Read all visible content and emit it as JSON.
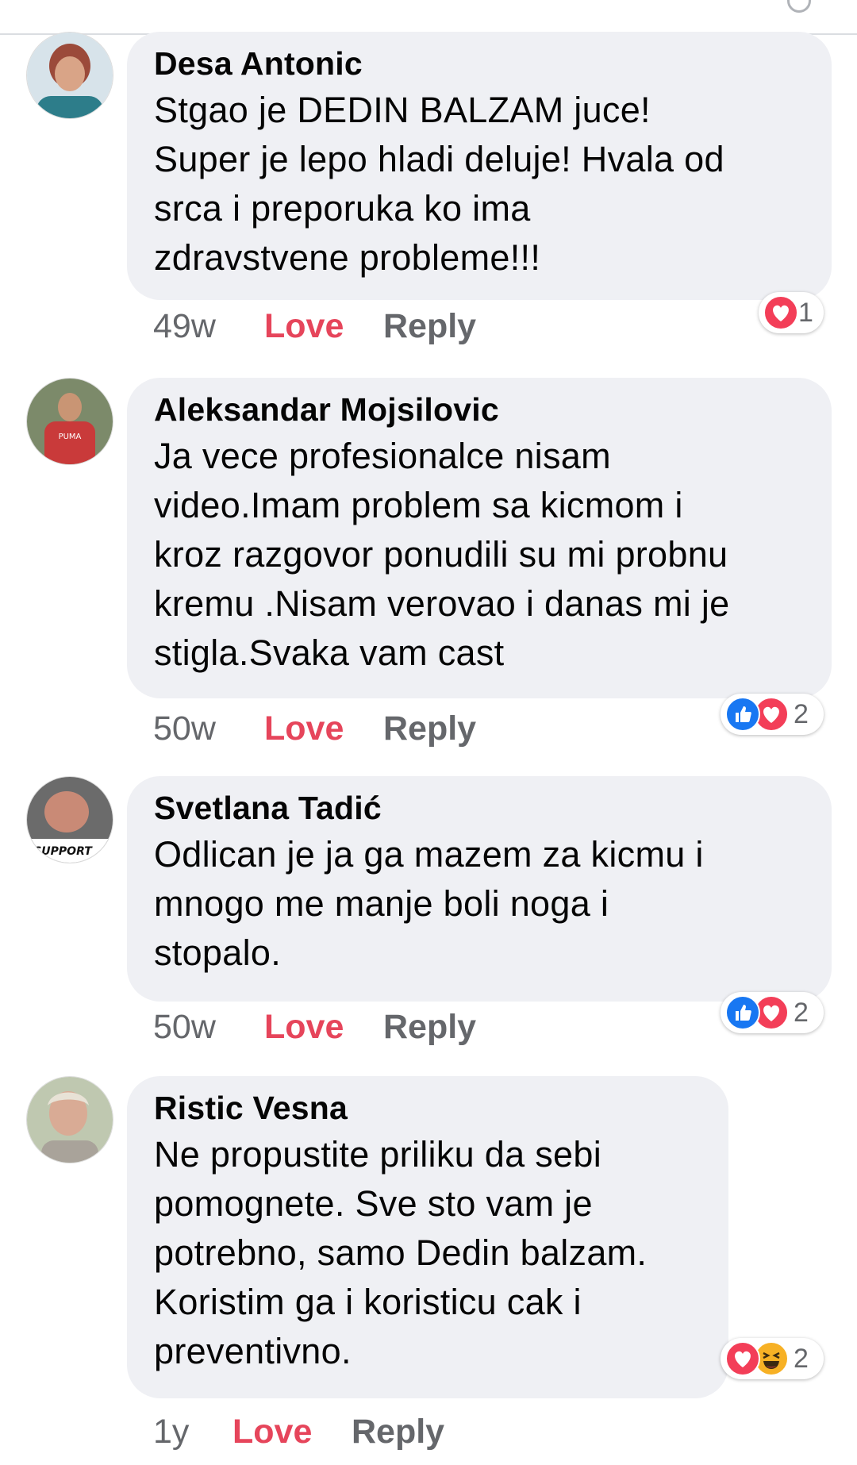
{
  "comments": [
    {
      "author": "Desa Antonic",
      "text": "Stgao je DEDIN BALZAM  juce! Super je lepo hladi deluje! Hvala od srca i preporuka ko ima zdravstvene probleme!!!",
      "lines": [
        "Stgao je DEDIN BALZAM  juce!",
        "Super je lepo hladi deluje! Hvala od",
        "srca i preporuka ko ima",
        "zdravstvene probleme!!!"
      ],
      "time": "49w",
      "love_label": "Love",
      "reply_label": "Reply",
      "reaction_icons": [
        "heart-icon"
      ],
      "reaction_count": "1"
    },
    {
      "author": "Aleksandar Mojsilovic",
      "lines": [
        "Ja vece profesionalce nisam",
        "video.Imam problem sa kicmom i",
        "kroz razgovor ponudili su mi probnu",
        "kremu .Nisam verovao i danas mi je",
        "stigla.Svaka vam cast"
      ],
      "time": "50w",
      "love_label": "Love",
      "reply_label": "Reply",
      "reaction_icons": [
        "like-icon",
        "heart-icon"
      ],
      "reaction_count": "2"
    },
    {
      "author": "Svetlana Tadić",
      "lines": [
        "Odlican je ja ga mazem za kicmu i",
        "mnogo me manje boli noga i",
        "stopalo."
      ],
      "time": "50w",
      "love_label": "Love",
      "reply_label": "Reply",
      "reaction_icons": [
        "like-icon",
        "heart-icon"
      ],
      "reaction_count": "2",
      "avatar_text": "SUPPORT"
    },
    {
      "author": "Ristic Vesna",
      "lines": [
        "Ne propustite priliku da sebi",
        "pomognete. Sve sto vam je",
        "potrebno, samo Dedin balzam.",
        "Koristim ga i koristicu cak i",
        "preventivno."
      ],
      "time": "1y",
      "love_label": "Love",
      "reply_label": "Reply",
      "reaction_icons": [
        "heart-icon",
        "haha-icon"
      ],
      "reaction_count": "2"
    }
  ],
  "colors": {
    "bubble": "#eff0f4",
    "love": "#e6455b",
    "secondary_text": "#65676b",
    "like_blue": "#1877f2",
    "heart_red": "#f33e58",
    "haha_yellow": "#f7b125"
  }
}
